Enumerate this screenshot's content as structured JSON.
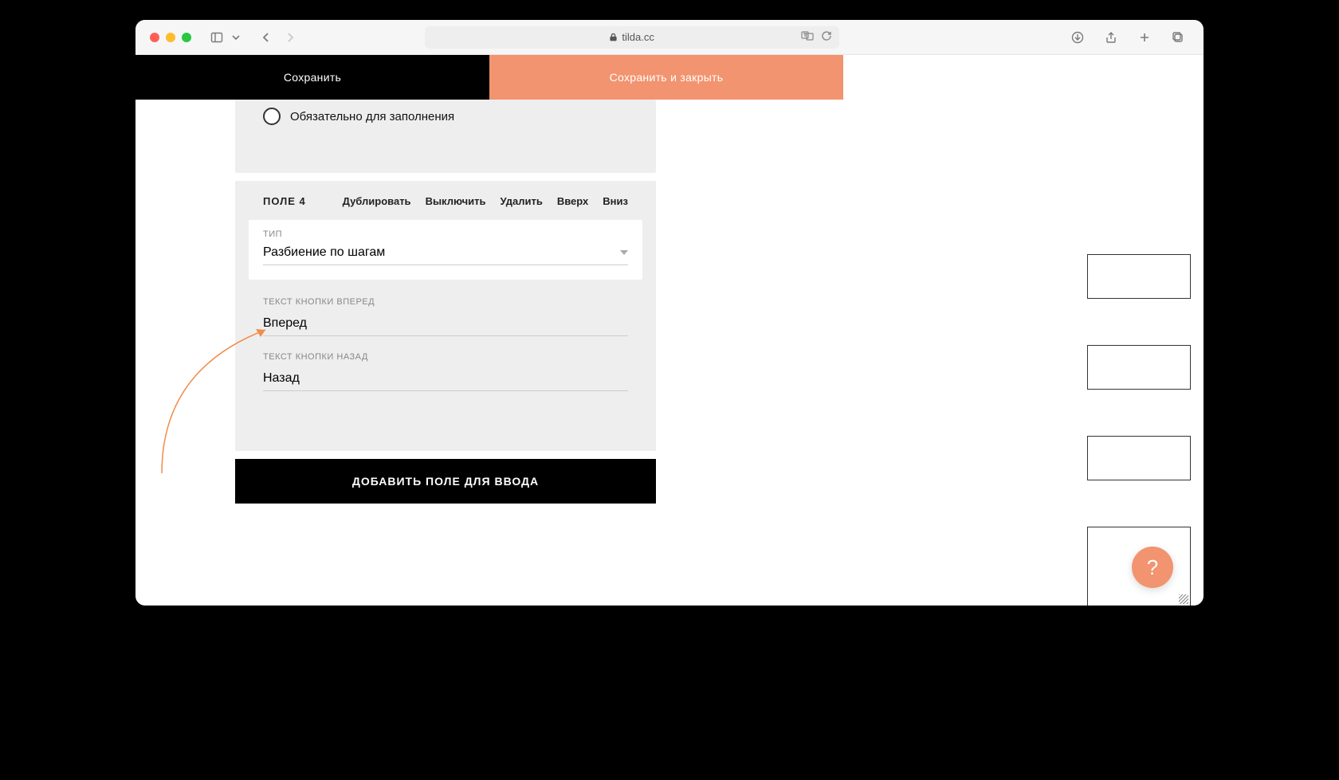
{
  "browser": {
    "url_domain": "tilda.cc"
  },
  "toolbar": {
    "save_label": "Сохранить",
    "save_close_label": "Сохранить и закрыть"
  },
  "panel_required": {
    "checkbox_label": "Обязательно для заполнения"
  },
  "field4": {
    "title": "ПОЛЕ 4",
    "actions": {
      "duplicate": "Дублировать",
      "disable": "Выключить",
      "delete": "Удалить",
      "up": "Вверх",
      "down": "Вниз"
    },
    "type_label": "ТИП",
    "type_value": "Разбиение по шагам",
    "next_label": "ТЕКСТ КНОПКИ ВПЕРЕД",
    "next_value": "Вперед",
    "back_label": "ТЕКСТ КНОПКИ НАЗАД",
    "back_value": "Назад"
  },
  "add_field_label": "ДОБАВИТЬ ПОЛЕ ДЛЯ ВВОДА",
  "help_label": "?"
}
